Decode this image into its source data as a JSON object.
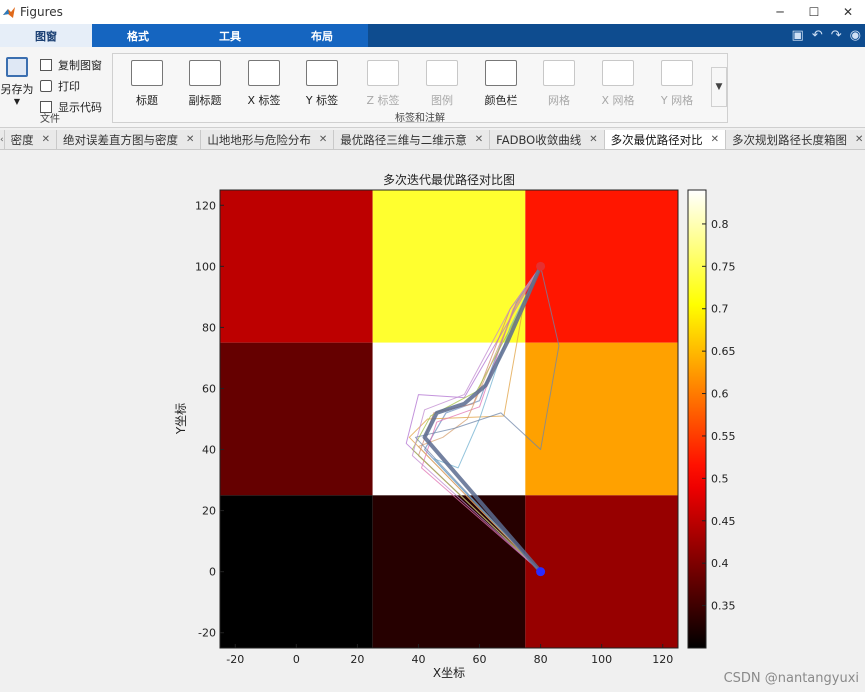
{
  "window": {
    "title": "Figures"
  },
  "ribbon_tabs": [
    "图窗",
    "格式",
    "工具",
    "布局"
  ],
  "file_group": {
    "label": "文件",
    "save_as": "另存为",
    "copy": "复制图窗",
    "print": "打印",
    "show_code": "显示代码"
  },
  "labels_group": {
    "label": "标签和注解",
    "buttons": [
      {
        "label": "标题",
        "enabled": true
      },
      {
        "label": "副标题",
        "enabled": true
      },
      {
        "label": "X 标签",
        "enabled": true
      },
      {
        "label": "Y 标签",
        "enabled": true
      },
      {
        "label": "Z 标签",
        "enabled": false
      },
      {
        "label": "图例",
        "enabled": false
      },
      {
        "label": "颜色栏",
        "enabled": true
      },
      {
        "label": "网格",
        "enabled": false
      },
      {
        "label": "X 网格",
        "enabled": false
      },
      {
        "label": "Y 网格",
        "enabled": false
      }
    ]
  },
  "doc_tabs": [
    {
      "label": "密度",
      "active": false
    },
    {
      "label": "绝对误差直方图与密度",
      "active": false
    },
    {
      "label": "山地地形与危险分布",
      "active": false
    },
    {
      "label": "最优路径三维与二维示意",
      "active": false
    },
    {
      "label": "FADBO收敛曲线",
      "active": false
    },
    {
      "label": "多次最优路径对比",
      "active": true
    },
    {
      "label": "多次规划路径长度箱图",
      "active": false
    }
  ],
  "watermark": "CSDN @nantangyuxi",
  "colors": {
    "ribbon_blue": "#0e4c8f",
    "start_point": "#2b2bff",
    "goal_point": "#e53030"
  },
  "chart_data": {
    "type": "heatmap",
    "title": "多次迭代最优路径对比图",
    "xlabel": "X坐标",
    "ylabel": "Y坐标",
    "xlim": [
      -25,
      125
    ],
    "ylim": [
      -25,
      125
    ],
    "xticks": [
      -20,
      0,
      20,
      40,
      60,
      80,
      100,
      120
    ],
    "yticks": [
      -20,
      0,
      20,
      40,
      60,
      80,
      100,
      120
    ],
    "colormap": "hot",
    "clim": [
      0.3,
      0.84
    ],
    "colorbar_ticks": [
      0.35,
      0.4,
      0.45,
      0.5,
      0.55,
      0.6,
      0.65,
      0.7,
      0.75,
      0.8
    ],
    "grid_centers_x": [
      0,
      50,
      100
    ],
    "grid_centers_y": [
      0,
      50,
      100
    ],
    "cell_values": [
      [
        0.45,
        0.73,
        0.52
      ],
      [
        0.38,
        0.84,
        0.63
      ],
      [
        0.3,
        0.33,
        0.42
      ]
    ],
    "start": [
      80,
      0
    ],
    "goal": [
      80,
      100
    ],
    "paths": [
      {
        "color": "#7090c0",
        "width": 1.2,
        "points": [
          [
            80,
            0
          ],
          [
            42,
            40
          ],
          [
            49,
            52
          ],
          [
            60,
            56
          ],
          [
            72,
            88
          ],
          [
            80,
            100
          ]
        ]
      },
      {
        "color": "#d08a70",
        "width": 1.0,
        "points": [
          [
            80,
            0
          ],
          [
            40,
            38
          ],
          [
            45,
            52
          ],
          [
            58,
            55
          ],
          [
            70,
            86
          ],
          [
            80,
            100
          ]
        ]
      },
      {
        "color": "#e0a040",
        "width": 1.0,
        "points": [
          [
            80,
            0
          ],
          [
            37,
            44
          ],
          [
            43,
            50
          ],
          [
            68,
            51
          ],
          [
            74,
            85
          ],
          [
            80,
            100
          ]
        ]
      },
      {
        "color": "#b070d0",
        "width": 1.0,
        "points": [
          [
            80,
            0
          ],
          [
            36,
            42
          ],
          [
            40,
            58
          ],
          [
            55,
            57
          ],
          [
            73,
            88
          ],
          [
            80,
            100
          ]
        ]
      },
      {
        "color": "#e070b0",
        "width": 1.0,
        "points": [
          [
            80,
            0
          ],
          [
            41,
            34
          ],
          [
            46,
            49
          ],
          [
            60,
            54
          ],
          [
            71,
            86
          ],
          [
            80,
            100
          ]
        ]
      },
      {
        "color": "#a0c040",
        "width": 1.0,
        "points": [
          [
            80,
            0
          ],
          [
            38,
            40
          ],
          [
            44,
            51
          ],
          [
            59,
            59
          ],
          [
            73,
            85
          ],
          [
            80,
            100
          ]
        ]
      },
      {
        "color": "#70b0d0",
        "width": 1.0,
        "points": [
          [
            80,
            0
          ],
          [
            45,
            37
          ],
          [
            53,
            34
          ],
          [
            60,
            50
          ],
          [
            70,
            80
          ],
          [
            80,
            100
          ]
        ]
      },
      {
        "color": "#d6a070",
        "width": 1.0,
        "points": [
          [
            80,
            0
          ],
          [
            40,
            41
          ],
          [
            48,
            44
          ],
          [
            56,
            50
          ],
          [
            72,
            87
          ],
          [
            80,
            100
          ]
        ]
      },
      {
        "color": "#c08ad0",
        "width": 1.0,
        "points": [
          [
            80,
            0
          ],
          [
            38,
            38
          ],
          [
            42,
            53
          ],
          [
            55,
            58
          ],
          [
            70,
            86
          ],
          [
            80,
            100
          ]
        ]
      },
      {
        "color": "#6f86a8",
        "width": 1.0,
        "points": [
          [
            80,
            0
          ],
          [
            39,
            44
          ],
          [
            52,
            47
          ],
          [
            67,
            52
          ],
          [
            80,
            40
          ],
          [
            86,
            74
          ],
          [
            80,
            100
          ]
        ]
      },
      {
        "color": "#5b6b8f",
        "width": 4.0,
        "points": [
          [
            80,
            0
          ],
          [
            42,
            44
          ],
          [
            46,
            52
          ],
          [
            55,
            55
          ],
          [
            62,
            61
          ],
          [
            69,
            75
          ],
          [
            80,
            100
          ]
        ]
      }
    ]
  }
}
